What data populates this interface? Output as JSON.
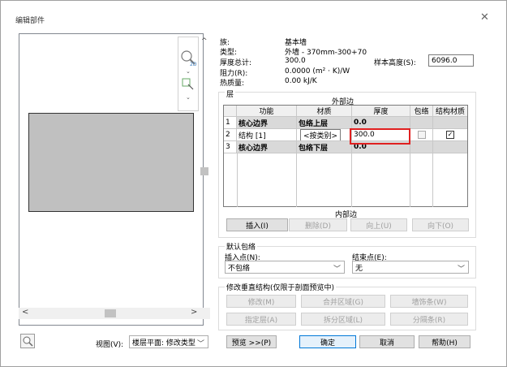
{
  "window": {
    "title": "编辑部件",
    "close_glyph": "✕"
  },
  "properties": {
    "family_label": "族:",
    "family_value": "基本墙",
    "type_label": "类型:",
    "type_value": "外墙 - 370mm-300+70",
    "thickness_label": "厚度总计:",
    "thickness_value": "300.0",
    "sample_height_label": "样本高度(S):",
    "sample_height_value": "6096.0",
    "resistance_label": "阻力(R):",
    "resistance_value": "0.0000 (m² · K)/W",
    "thermal_mass_label": "热质量:",
    "thermal_mass_value": "0.00 kJ/K"
  },
  "layers": {
    "section_label": "层",
    "exterior_side": "外部边",
    "interior_side": "内部边",
    "columns": [
      "功能",
      "材质",
      "厚度",
      "包络",
      "结构材质"
    ],
    "rows": [
      {
        "num": "1",
        "function": "核心边界",
        "material": "包络上层",
        "thickness": "0.0"
      },
      {
        "num": "2",
        "function": "结构 [1]",
        "material": "<按类别>",
        "thickness": "300.0"
      },
      {
        "num": "3",
        "function": "核心边界",
        "material": "包络下层",
        "thickness": "0.0"
      }
    ],
    "buttons": {
      "insert": "插入(I)",
      "delete": "删除(D)",
      "up": "向上(U)",
      "down": "向下(O)"
    }
  },
  "wrapping": {
    "group_label": "默认包络",
    "insert_point_label": "插入点(N):",
    "insert_point_value": "不包络",
    "end_point_label": "结束点(E):",
    "end_point_value": "无"
  },
  "vertical": {
    "group_label": "修改垂直结构(仅限于剖面预览中)",
    "modify": "修改(M)",
    "merge": "合并区域(G)",
    "sweeps": "墙饰条(W)",
    "assign": "指定层(A)",
    "split": "拆分区域(L)",
    "reveals": "分隔条(R)"
  },
  "footer": {
    "view_label": "视图(V):",
    "view_value": "楼层平面: 修改类型",
    "preview": "预览 >>(P)",
    "ok": "确定",
    "cancel": "取消",
    "help": "帮助(H)"
  },
  "icons": [
    "zoom-2d-icon",
    "dropdown-icon",
    "zoom-region-icon",
    "zoom-small-icon"
  ],
  "highlight_color": "#e02020"
}
